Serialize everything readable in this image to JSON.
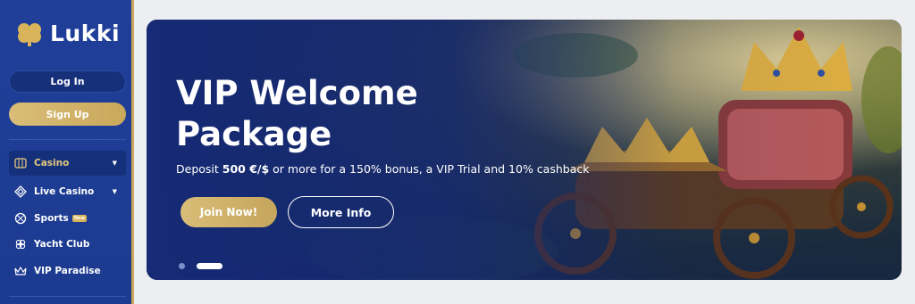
{
  "brand": {
    "name": "Lukki"
  },
  "auth": {
    "login_label": "Log In",
    "signup_label": "Sign Up"
  },
  "nav": {
    "casino": "Casino",
    "live_casino": "Live Casino",
    "sports": "Sports",
    "sports_badge": "New",
    "yacht_club": "Yacht Club",
    "vip_paradise": "VIP Paradise"
  },
  "hero": {
    "title": "VIP Welcome Package",
    "subtitle_prefix": "Deposit ",
    "subtitle_bold": "500 €/$",
    "subtitle_suffix": " or more for a 150% bonus, a VIP Trial and 10% cashback",
    "join_label": "Join Now!",
    "more_label": "More Info"
  },
  "carousel": {
    "slide_count": 2,
    "active_index": 1
  },
  "colors": {
    "sidebar": "#1f3f9a",
    "gold": "#c9a85a",
    "banner_blue": "#162a78"
  }
}
